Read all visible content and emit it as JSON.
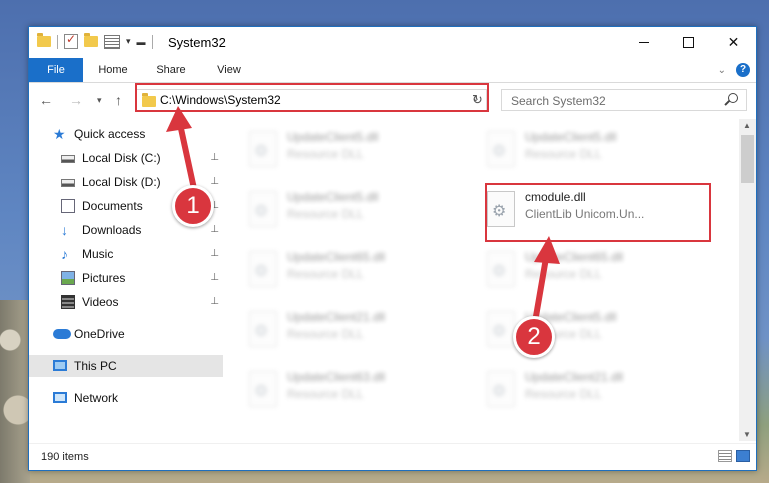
{
  "window": {
    "title": "System32",
    "minimize_label": "—",
    "close_label": "✕"
  },
  "ribbon": {
    "tabs": [
      "File",
      "Home",
      "Share",
      "View"
    ]
  },
  "address": {
    "path": "C:\\Windows\\System32"
  },
  "search": {
    "placeholder": "Search System32"
  },
  "nav_pane": {
    "items": [
      {
        "label": "Quick access",
        "icon": "star-icon"
      },
      {
        "label": "Local Disk (C:)",
        "icon": "drive-icon",
        "pinned": true
      },
      {
        "label": "Local Disk (D:)",
        "icon": "drive-icon",
        "pinned": true
      },
      {
        "label": "Documents",
        "icon": "documents-icon",
        "pinned": true
      },
      {
        "label": "Downloads",
        "icon": "download-icon",
        "pinned": true
      },
      {
        "label": "Music",
        "icon": "music-icon",
        "pinned": true
      },
      {
        "label": "Pictures",
        "icon": "pictures-icon",
        "pinned": true
      },
      {
        "label": "Videos",
        "icon": "videos-icon",
        "pinned": true
      },
      {
        "label": "OneDrive",
        "icon": "cloud-icon"
      },
      {
        "label": "This PC",
        "icon": "computer-icon",
        "selected": true
      },
      {
        "label": "Network",
        "icon": "network-icon"
      }
    ],
    "pin_glyph": "📌"
  },
  "files": [
    {
      "name": "UpdateClient5.dll",
      "desc": "Resource DLL",
      "blurred": true
    },
    {
      "name": "UpdateClient5.dll",
      "desc": "Resource DLL",
      "blurred": true
    },
    {
      "name": "UpdateClient5.dll",
      "desc": "Resource DLL",
      "blurred": true
    },
    {
      "name": "cmodule.dll",
      "desc": "ClientLib Unicom.Un...",
      "blurred": false
    },
    {
      "name": "UpdateClient65.dll",
      "desc": "Resource DLL",
      "blurred": true
    },
    {
      "name": "UpdateClient65.dll",
      "desc": "Resource DLL",
      "blurred": true
    },
    {
      "name": "UpdateClient21.dll",
      "desc": "Resource DLL",
      "blurred": true
    },
    {
      "name": "UpdateClient5.dll",
      "desc": "Resource DLL",
      "blurred": true
    },
    {
      "name": "UpdateClient63.dll",
      "desc": "Resource DLL",
      "blurred": true
    },
    {
      "name": "UpdateClient21.dll",
      "desc": "Resource DLL",
      "blurred": true
    }
  ],
  "status": {
    "item_count": "190 items"
  },
  "annotations": {
    "step1": "1",
    "step2": "2",
    "color": "#d9363e"
  }
}
